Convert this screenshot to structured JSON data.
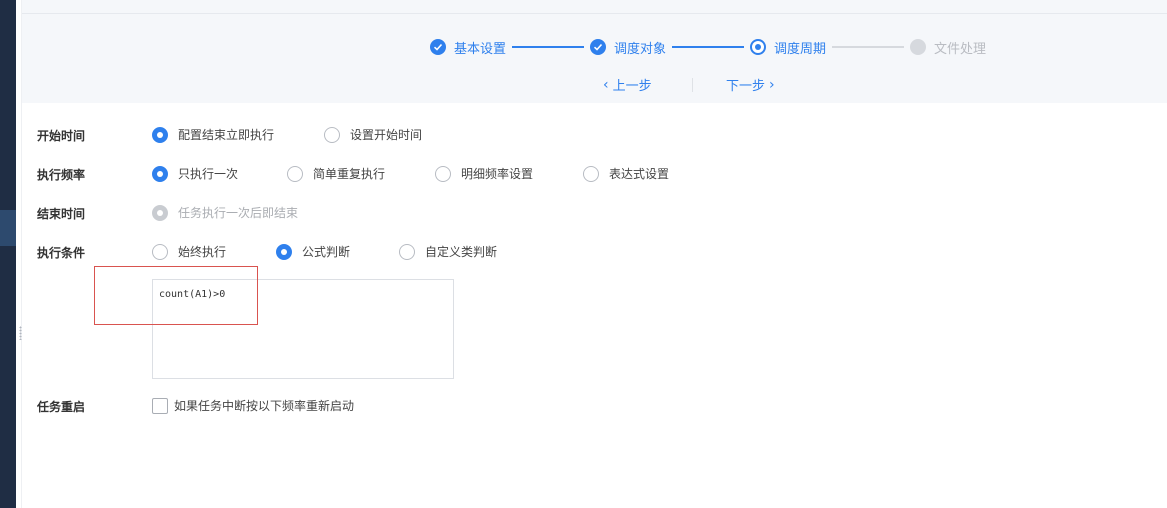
{
  "wizard": {
    "steps": [
      {
        "label": "基本设置",
        "state": "done"
      },
      {
        "label": "调度对象",
        "state": "done"
      },
      {
        "label": "调度周期",
        "state": "current"
      },
      {
        "label": "文件处理",
        "state": "todo"
      }
    ],
    "prev_label": "上一步",
    "next_label": "下一步"
  },
  "form": {
    "start_time": {
      "label": "开始时间",
      "options": [
        "配置结束立即执行",
        "设置开始时间"
      ],
      "selected": 0
    },
    "frequency": {
      "label": "执行频率",
      "options": [
        "只执行一次",
        "简单重复执行",
        "明细频率设置",
        "表达式设置"
      ],
      "selected": 0
    },
    "end_time": {
      "label": "结束时间",
      "options": [
        "任务执行一次后即结束"
      ],
      "selected": 0,
      "disabled": true
    },
    "condition": {
      "label": "执行条件",
      "options": [
        "始终执行",
        "公式判断",
        "自定义类判断"
      ],
      "selected": 1,
      "formula": "count(A1)>0"
    },
    "restart": {
      "label": "任务重启",
      "checkbox_label": "如果任务中断按以下频率重新启动",
      "checked": false
    }
  },
  "colors": {
    "accent": "#2f80ed",
    "sidebar": "#1f2d44",
    "highlight": "#d9534f"
  }
}
